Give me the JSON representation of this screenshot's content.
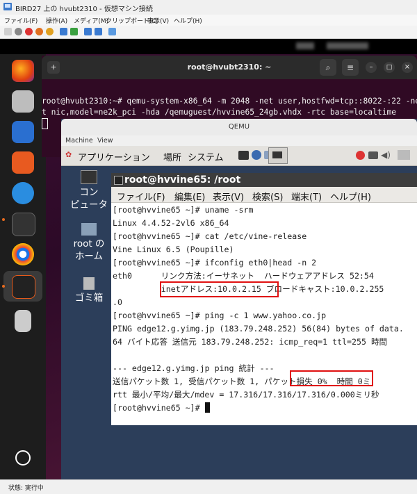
{
  "hyperv": {
    "title": "BIRD27 上の hvubt2310 - 仮想マシン接続",
    "menu": [
      "ファイル(F)",
      "操作(A)",
      "メディア(M)",
      "クリップボード(C)",
      "表示(V)",
      "ヘルプ(H)"
    ],
    "status": "状態: 実行中"
  },
  "gnome_terminal": {
    "title": "root@hvubt2310: ~",
    "lines": [
      "root@hvubt2310:~# qemu-system-x86_64 -m 2048 -net user,hostfwd=tcp::8022-:22 -ne",
      "t nic,model=ne2k_pci -hda /qemuguest/hvvine65_24gb.vhdx -rtc base=localtime"
    ]
  },
  "qemu": {
    "title": "QEMU",
    "menu": [
      "Machine",
      "View"
    ],
    "panel": [
      "アプリケーション",
      "場所",
      "システム"
    ],
    "desktop_icons": [
      {
        "label1": "コン",
        "label2": "ピュータ"
      },
      {
        "label1": "root の",
        "label2": "ホーム"
      },
      {
        "label1": "ゴミ箱",
        "label2": ""
      }
    ]
  },
  "vine_terminal": {
    "title": "root@hvvine65: /root",
    "menu": [
      "ファイル(F)",
      "編集(E)",
      "表示(V)",
      "検索(S)",
      "端末(T)",
      "ヘルプ(H)"
    ],
    "lines": [
      "[root@hvvine65 ~]# uname -srm",
      "Linux 4.4.52-2vl6 x86_64",
      "[root@hvvine65 ~]# cat /etc/vine-release",
      "Vine Linux 6.5 (Poupille)",
      "[root@hvvine65 ~]# ifconfig eth0|head -n 2",
      "eth0      リンク方法:イーサネット  ハードウェアアドレス 52:54",
      "          inetアドレス:10.0.2.15 ブロードキャスト:10.0.2.255",
      ".0",
      "[root@hvvine65 ~]# ping -c 1 www.yahoo.co.jp",
      "PING edge12.g.yimg.jp (183.79.248.252) 56(84) bytes of data.",
      "64 バイト応答 送信元 183.79.248.252: icmp_req=1 ttl=255 時間",
      "",
      "--- edge12.g.yimg.jp ping 統計 ---",
      "送信パケット数 1, 受信パケット数 1, パケット損失 0%  時間 0ミ",
      "rtt 最小/平均/最大/mdev = 17.316/17.316/17.316/0.000ミリ秒",
      "[root@hvvine65 ~]# "
    ]
  }
}
